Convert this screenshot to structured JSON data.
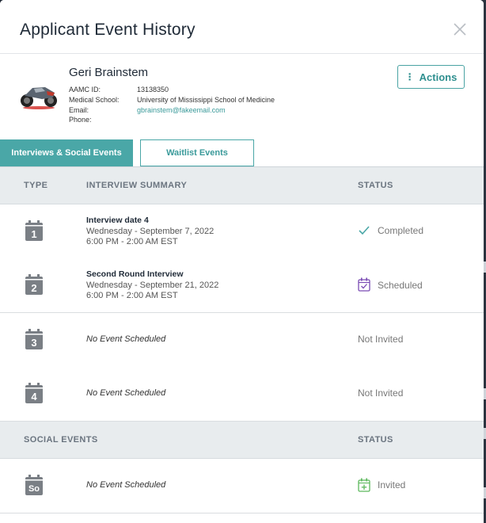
{
  "modal": {
    "title": "Applicant Event History"
  },
  "applicant": {
    "name": "Geri Brainstem",
    "fields": [
      {
        "label": "AAMC ID:",
        "value": "13138350"
      },
      {
        "label": "Medical School:",
        "value": "University of Mississippi School of Medicine"
      },
      {
        "label": "Email:",
        "value": "gbrainstem@fakeemail.com"
      },
      {
        "label": "Phone:",
        "value": ""
      }
    ],
    "actions_label": "Actions"
  },
  "tabs": [
    {
      "label": "Interviews & Social Events",
      "active": true
    },
    {
      "label": "Waitlist Events",
      "active": false
    }
  ],
  "interviews": {
    "headers": {
      "type": "TYPE",
      "summary": "INTERVIEW SUMMARY",
      "status": "STATUS"
    },
    "rows": [
      {
        "icon_number": "1",
        "title": "Interview date 4",
        "date": "Wednesday - September 7, 2022",
        "time": "6:00 PM - 2:00 AM EST",
        "empty": "",
        "status": "Completed",
        "status_icon": "check-icon"
      },
      {
        "icon_number": "2",
        "title": "Second Round Interview",
        "date": "Wednesday - September 21, 2022",
        "time": "6:00 PM - 2:00 AM EST",
        "empty": "",
        "status": "Scheduled",
        "status_icon": "calendar-check-icon"
      },
      {
        "icon_number": "3",
        "title": "",
        "date": "",
        "time": "",
        "empty": "No Event Scheduled",
        "status": "Not Invited",
        "status_icon": ""
      },
      {
        "icon_number": "4",
        "title": "",
        "date": "",
        "time": "",
        "empty": "No Event Scheduled",
        "status": "Not Invited",
        "status_icon": ""
      }
    ]
  },
  "social": {
    "headers": {
      "type": "SOCIAL EVENTS",
      "status": "STATUS"
    },
    "rows": [
      {
        "icon_number": "So",
        "empty": "No Event Scheduled",
        "status": "Invited",
        "status_icon": "calendar-plus-icon"
      }
    ]
  },
  "colors": {
    "accent": "#4aa7a7",
    "scheduled_icon": "#7a4bb3",
    "invited_icon": "#5cb85c",
    "completed_icon": "#4aa7a7"
  }
}
